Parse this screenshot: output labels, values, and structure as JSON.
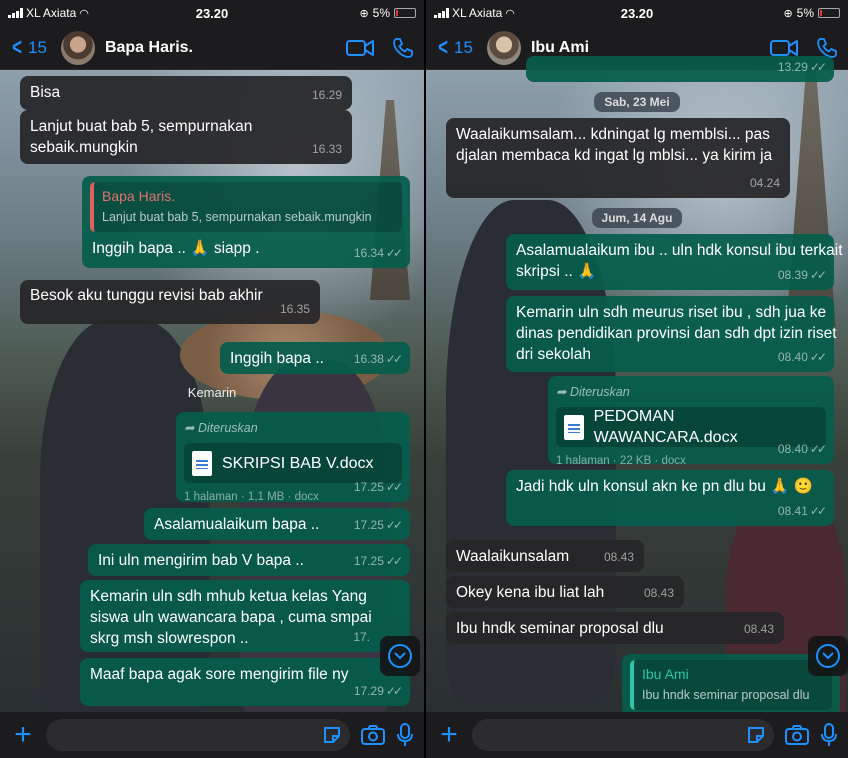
{
  "status": {
    "carrier": "XL Axiata",
    "time": "23.20",
    "battery": "5%"
  },
  "colors": {
    "accent": "#1e90ff",
    "outgoing": "#055c4b",
    "incoming": "#262628"
  },
  "left": {
    "header": {
      "back_count": "15",
      "contact_name": "Bapa Haris."
    },
    "messages": [
      {
        "text": "Bisa",
        "time": "16.29"
      },
      {
        "text": "Lanjut buat bab 5, sempurnakan sebaik.mungkin",
        "time": "16.33"
      },
      {
        "quote_name": "Bapa Haris.",
        "quote_text": "Lanjut buat bab 5, sempurnakan sebaik.mungkin",
        "text": "Inggih bapa .. 🙏 siapp .",
        "time": "16.34"
      },
      {
        "text": "Besok aku tunggu revisi bab akhir",
        "time": "16.35"
      },
      {
        "text": "Inggih bapa ..",
        "time": "16.38"
      },
      {
        "day": "Kemarin"
      },
      {
        "forwarded": "Diteruskan",
        "file_name": "SKRIPSI BAB V.docx",
        "file_meta": "1 halaman · 1,1 MB · docx",
        "time": "17.25"
      },
      {
        "text": "Asalamualaikum bapa ..",
        "time": "17.25"
      },
      {
        "text": "Ini uln mengirim bab V bapa ..",
        "time": "17.25"
      },
      {
        "text": "Kemarin uln sdh mhub ketua kelas Yang siswa uln wawancara bapa , cuma smpai skrg msh slowrespon ..",
        "time": "17."
      },
      {
        "text": "Maaf bapa agak sore mengirim file ny",
        "time": "17.29"
      }
    ]
  },
  "right": {
    "header": {
      "back_count": "15",
      "contact_name": "Ibu Ami"
    },
    "messages": [
      {
        "time": "13.29"
      },
      {
        "day": "Sab, 23 Mei"
      },
      {
        "text": "Waalaikumsalam... kdningat lg memblsi... pas djalan membaca kd ingat lg mblsi... ya kirim ja",
        "time": "04.24"
      },
      {
        "day": "Jum, 14 Agu"
      },
      {
        "text": "Asalamualaikum ibu .. uln hdk konsul ibu terkait skripsi .. 🙏",
        "time": "08.39"
      },
      {
        "text": "Kemarin uln sdh meurus riset ibu , sdh jua ke dinas pendidikan provinsi dan sdh dpt izin riset dri sekolah",
        "time": "08.40"
      },
      {
        "forwarded": "Diteruskan",
        "file_name": "PEDOMAN WAWANCARA.docx",
        "file_meta": "1 halaman · 22 KB · docx",
        "time": "08.40"
      },
      {
        "text": "Jadi hdk uln konsul akn ke pn dlu bu 🙏 🙂",
        "time": "08.41"
      },
      {
        "text": "Waalaikunsalam",
        "time": "08.43"
      },
      {
        "text": "Okey kena ibu liat lah",
        "time": "08.43"
      },
      {
        "text": "Ibu hndk seminar proposal dlu",
        "time": "08.43"
      },
      {
        "quote_name": "Ibu Ami",
        "quote_text": "Ibu hndk seminar proposal dlu"
      }
    ]
  }
}
